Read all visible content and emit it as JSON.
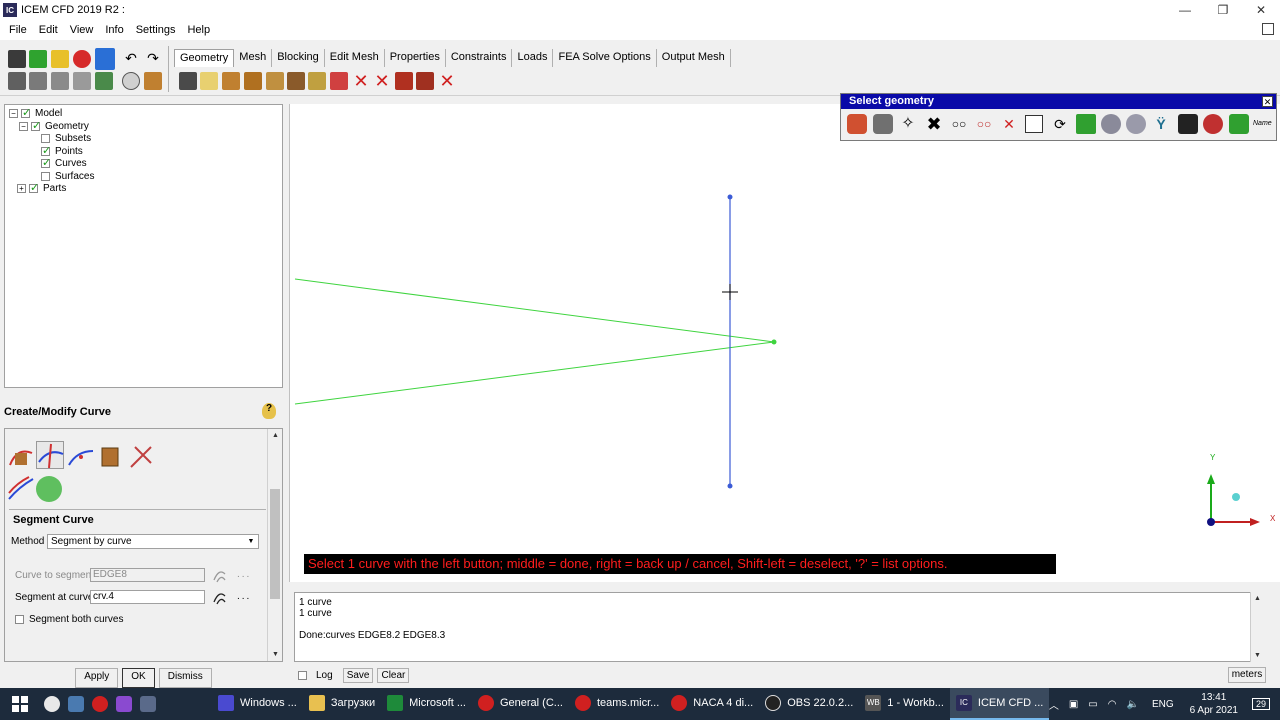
{
  "window": {
    "title": "ICEM CFD 2019 R2 :",
    "app_icon": "IC",
    "controls": [
      "—",
      "❐",
      "✕"
    ]
  },
  "menu": [
    "File",
    "Edit",
    "View",
    "Info",
    "Settings",
    "Help"
  ],
  "tabs": [
    "Geometry",
    "Mesh",
    "Blocking",
    "Edit Mesh",
    "Properties",
    "Constraints",
    "Loads",
    "FEA Solve Options",
    "Output Mesh"
  ],
  "active_tab": "Geometry",
  "tree": {
    "model": "Model",
    "geometry": "Geometry",
    "subsets": "Subsets",
    "points": "Points",
    "curves": "Curves",
    "surfaces": "Surfaces",
    "parts": "Parts"
  },
  "create_modify": {
    "title": "Create/Modify Curve",
    "help": "?",
    "section": "Segment Curve",
    "method_label": "Method",
    "method_value": "Segment by curve",
    "curve_to_segment_label": "Curve to segment",
    "curve_to_segment_value": "EDGE8",
    "segment_at_curve_label": "Segment at curve",
    "segment_at_curve_value": "crv.4",
    "segment_both_label": "Segment both curves",
    "dots": "...",
    "apply": "Apply",
    "ok": "OK",
    "dismiss": "Dismiss"
  },
  "select_geometry": {
    "title": "Select geometry",
    "name_label": "Name"
  },
  "status_message": "Select 1 curve with the left button; middle = done, right = back up / cancel, Shift-left = deselect, '?' = list options.",
  "console": {
    "lines": [
      "1 curve",
      "1 curve",
      "",
      "Done:curves EDGE8.2 EDGE8.3"
    ],
    "log_label": "Log",
    "save_label": "Save",
    "clear_label": "Clear",
    "units": "meters"
  },
  "axis": {
    "y": "Y",
    "x": "X"
  },
  "taskbar": {
    "tasks": [
      "Windows ...",
      "Загрузки",
      "Microsoft ...",
      "General (C...",
      "teams.micr...",
      "NACA 4 di...",
      "OBS 22.0.2...",
      "1 - Workb...",
      "ICEM CFD ..."
    ],
    "active_index": 8,
    "lang": "ENG",
    "time": "13:41",
    "date": "6 Apr 2021",
    "notifications": "29"
  },
  "colors": {
    "status_bg": "#000000",
    "status_text": "#ff1e1e",
    "curve_blue": "#3b5bd6",
    "curve_green": "#3fd43f",
    "palette_title": "#0a0aa8"
  }
}
